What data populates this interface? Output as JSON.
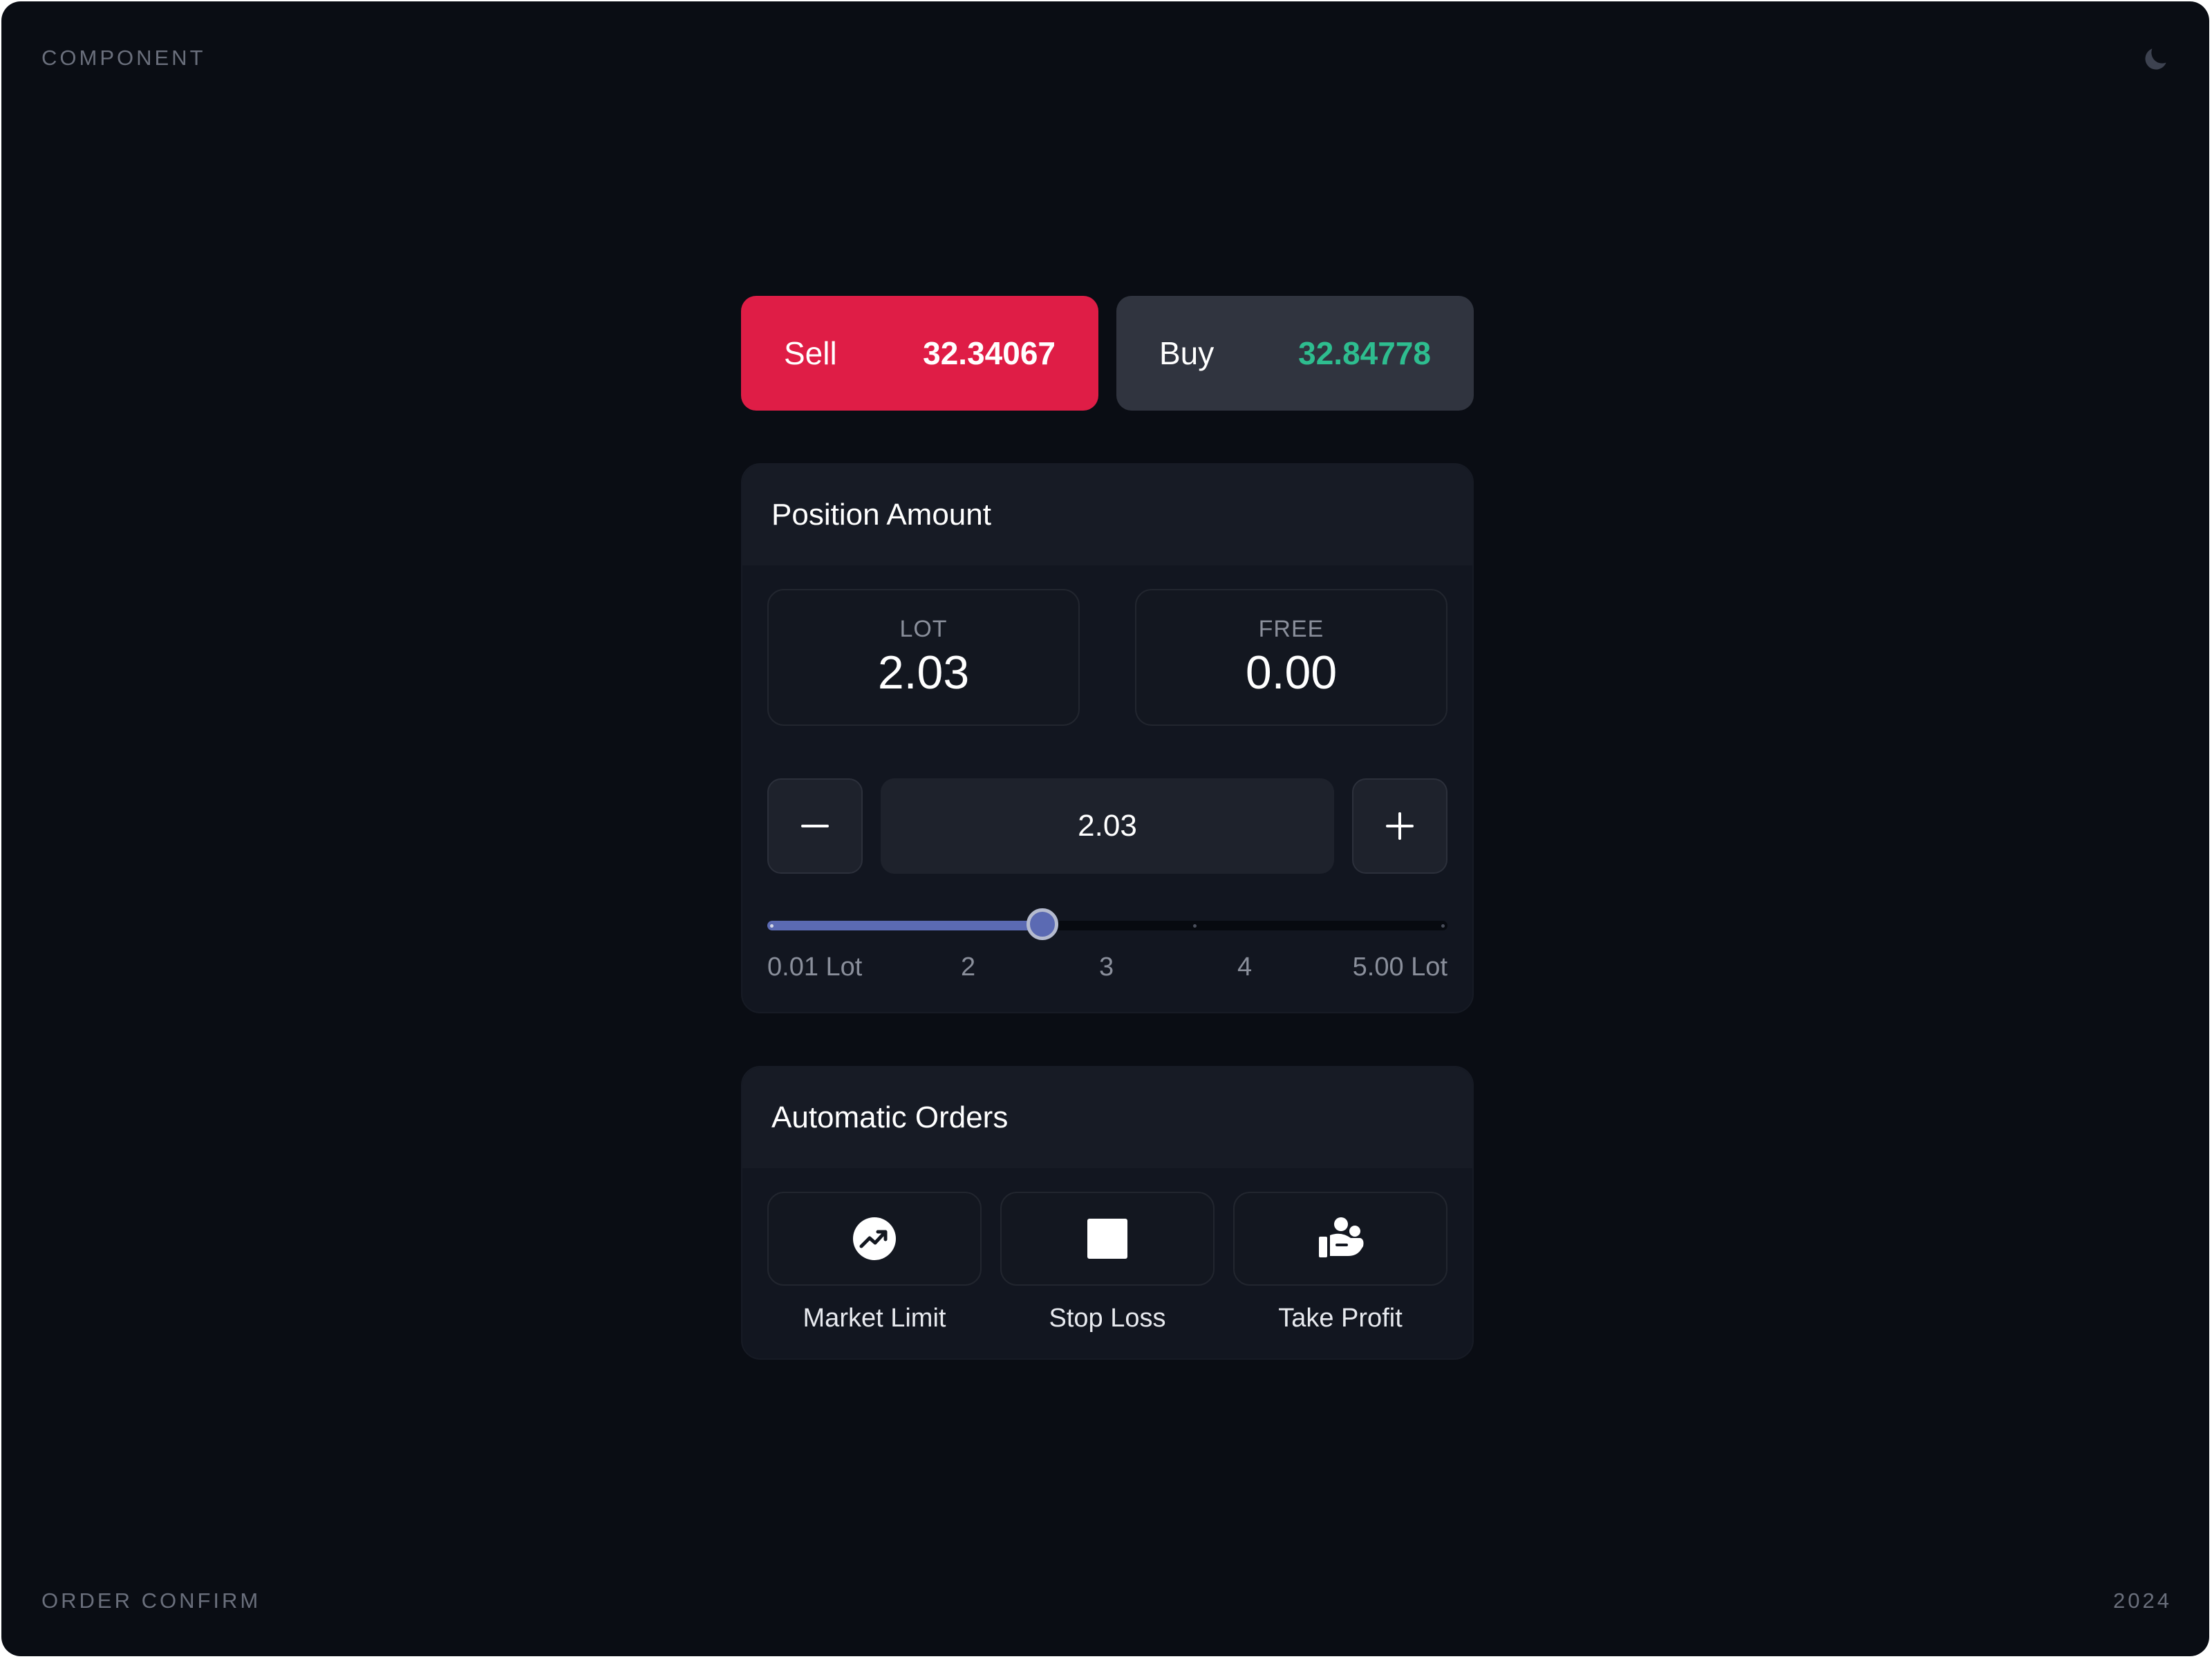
{
  "corners": {
    "top_left": "COMPONENT",
    "bottom_left": "ORDER CONFIRM",
    "bottom_right": "2024",
    "theme_icon": "moon-icon"
  },
  "trade": {
    "sell": {
      "label": "Sell",
      "price": "32.34067",
      "color": "#df1d46"
    },
    "buy": {
      "label": "Buy",
      "price": "32.84778",
      "price_color": "#2ebd8f"
    }
  },
  "position": {
    "title": "Position Amount",
    "lot": {
      "label": "LOT",
      "value": "2.03"
    },
    "free": {
      "label": "FREE",
      "value": "0.00"
    },
    "stepper_value": "2.03",
    "slider": {
      "min": 0.01,
      "max": 5.0,
      "value": 2.03,
      "accent": "#5b6ab3",
      "ticks": [
        "0.01 Lot",
        "2",
        "3",
        "4",
        "5.00 Lot"
      ]
    }
  },
  "automatic": {
    "title": "Automatic Orders",
    "items": [
      {
        "label": "Market Limit",
        "icon": "trending-up-circle-icon"
      },
      {
        "label": "Stop Loss",
        "icon": "stop-square-icon"
      },
      {
        "label": "Take Profit",
        "icon": "people-hand-icon"
      }
    ]
  }
}
